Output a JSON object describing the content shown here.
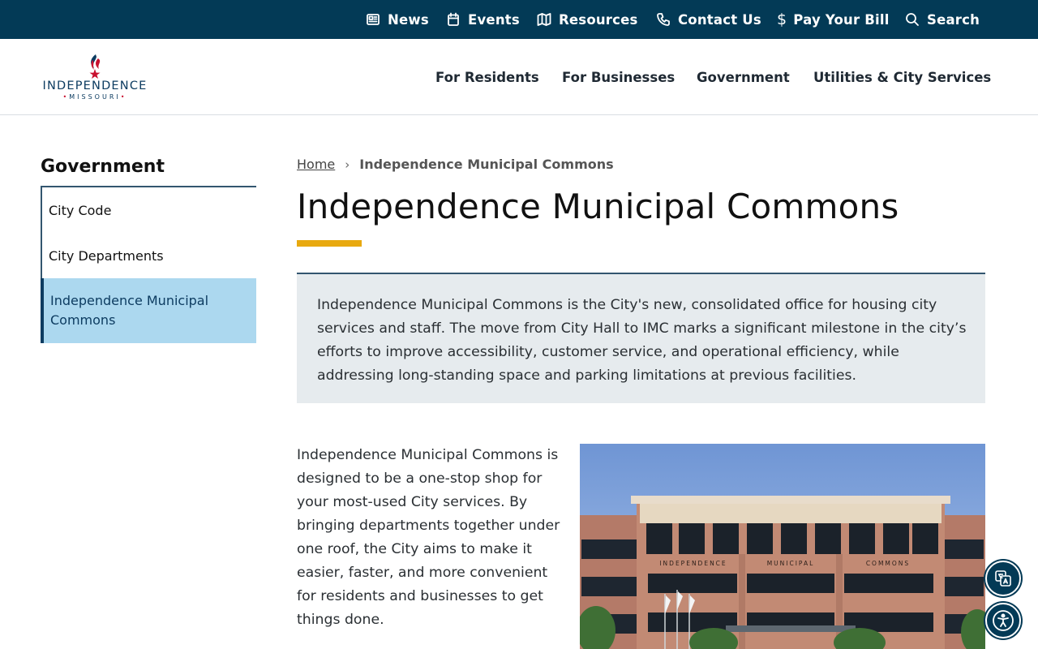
{
  "utility_nav": {
    "items": [
      {
        "label": "News",
        "icon": "newspaper-icon"
      },
      {
        "label": "Events",
        "icon": "calendar-icon"
      },
      {
        "label": "Resources",
        "icon": "map-icon"
      },
      {
        "label": "Contact Us",
        "icon": "phone-icon"
      },
      {
        "label": "Pay Your Bill",
        "icon": "dollar-icon"
      },
      {
        "label": "Search",
        "icon": "search-icon"
      }
    ],
    "background": "#033a56"
  },
  "logo": {
    "name": "INDEPENDENCE",
    "sub": "MISSOURI"
  },
  "main_nav": {
    "items": [
      {
        "label": "For Residents"
      },
      {
        "label": "For Businesses"
      },
      {
        "label": "Government"
      },
      {
        "label": "Utilities & City Services"
      }
    ]
  },
  "sidebar": {
    "title": "Government",
    "items": [
      {
        "label": "City Code",
        "active": false
      },
      {
        "label": "City Departments",
        "active": false
      },
      {
        "label": "Independence Municipal Commons",
        "active": true
      }
    ]
  },
  "breadcrumb": {
    "home": "Home",
    "current": "Independence Municipal Commons"
  },
  "page": {
    "title": "Independence Municipal Commons",
    "accent_color": "#e8a90f",
    "intro": "Independence Municipal Commons is the City's new, consolidated office for housing city services and staff. The move from City Hall to IMC marks a significant milestone in the city’s efforts to improve accessibility, customer service, and operational efficiency, while addressing long-standing space and parking limitations at previous facilities.",
    "body": "Independence Municipal Commons is designed to be a one-stop shop for your most-used City services. By bringing departments together under one roof, the City aims to make it easier, faster, and more convenient for residents and businesses to get things done."
  },
  "building_sign": {
    "left": "INDEPENDENCE",
    "middle": "MUNICIPAL",
    "right": "COMMONS"
  },
  "floating": {
    "translate_icon": "translate-icon",
    "accessibility_icon": "accessibility-icon"
  }
}
